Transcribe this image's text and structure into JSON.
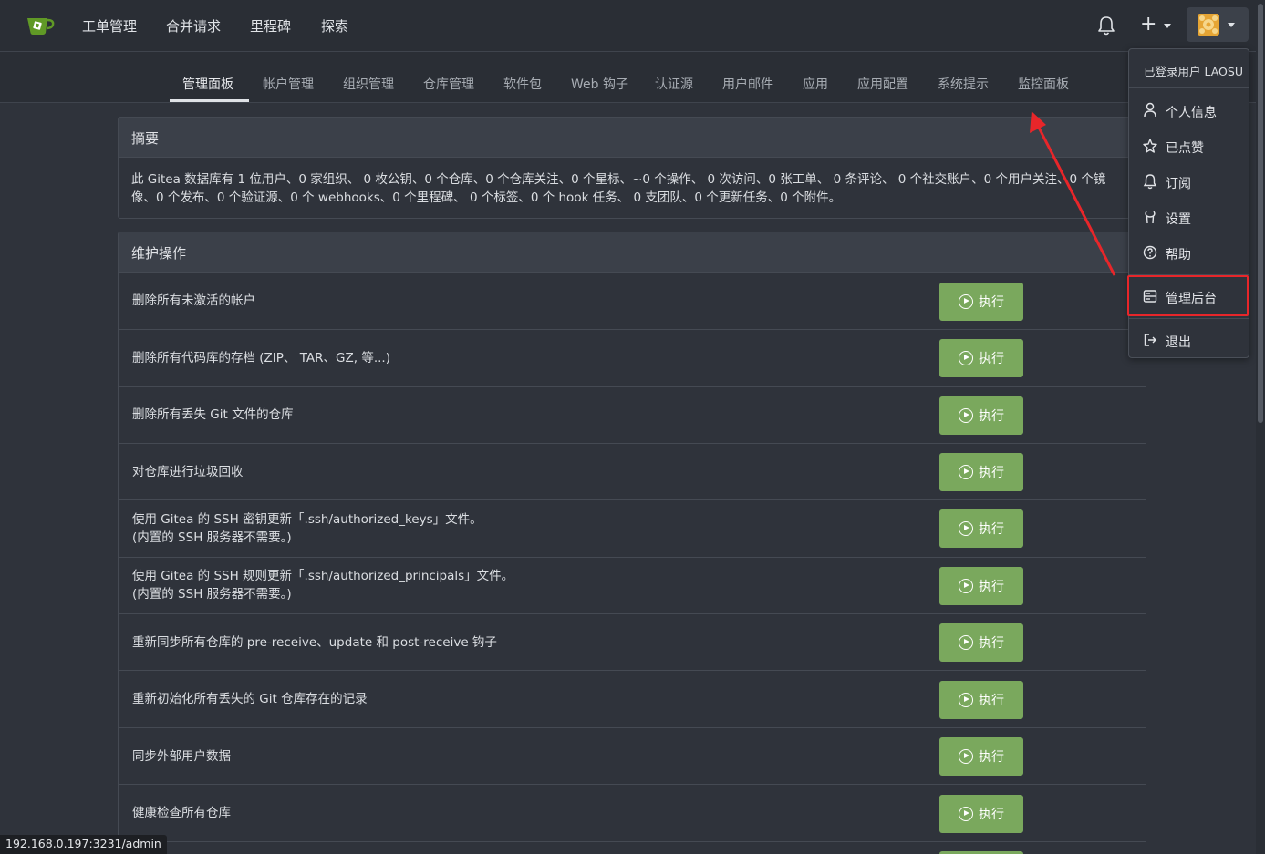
{
  "nav": {
    "items": [
      "工单管理",
      "合并请求",
      "里程碑",
      "探索"
    ],
    "plus": "+"
  },
  "tabs": [
    "管理面板",
    "帐户管理",
    "组织管理",
    "仓库管理",
    "软件包",
    "Web 钩子",
    "认证源",
    "用户邮件",
    "应用",
    "应用配置",
    "系统提示",
    "监控面板"
  ],
  "summary": {
    "title": "摘要",
    "text_line1": "此 Gitea 数据库有 1 位用户、0 家组织、 0 枚公钥、0 个仓库、0 个仓库关注、0 个星标、~0 个操作、 0 次访问、0 张工单、 0 条评论、 0 个社交账户、0 个用户关注、0 个镜",
    "text_line2": "像、0 个发布、0 个验证源、0 个 webhooks、0 个里程碑、 0 个标签、0 个 hook 任务、 0 支团队、0 个更新任务、0 个附件。"
  },
  "maintenance": {
    "title": "维护操作",
    "button_label": "执行",
    "rows": [
      {
        "line1": "删除所有未激活的帐户",
        "line2": ""
      },
      {
        "line1": "删除所有代码库的存档 (ZIP、 TAR、GZ, 等...)",
        "line2": ""
      },
      {
        "line1": "删除所有丢失 Git 文件的仓库",
        "line2": ""
      },
      {
        "line1": "对仓库进行垃圾回收",
        "line2": ""
      },
      {
        "line1": "使用 Gitea 的 SSH 密钥更新「.ssh/authorized_keys」文件。",
        "line2": "(内置的 SSH 服务器不需要。)"
      },
      {
        "line1": "使用 Gitea 的 SSH 规则更新「.ssh/authorized_principals」文件。",
        "line2": "(内置的 SSH 服务器不需要。)"
      },
      {
        "line1": "重新同步所有仓库的 pre-receive、update 和 post-receive 钩子",
        "line2": ""
      },
      {
        "line1": "重新初始化所有丢失的 Git 仓库存在的记录",
        "line2": ""
      },
      {
        "line1": "同步外部用户数据",
        "line2": ""
      },
      {
        "line1": "健康检查所有仓库",
        "line2": ""
      }
    ]
  },
  "dropdown": {
    "header": "已登录用户 LAOSU",
    "items": [
      "个人信息",
      "已点赞",
      "订阅",
      "设置",
      "帮助",
      "管理后台",
      "退出"
    ]
  },
  "statusbar": "192.168.0.197:3231/admin",
  "colors": {
    "accent_green": "#7aa85d",
    "highlight_red": "#e8262a"
  }
}
